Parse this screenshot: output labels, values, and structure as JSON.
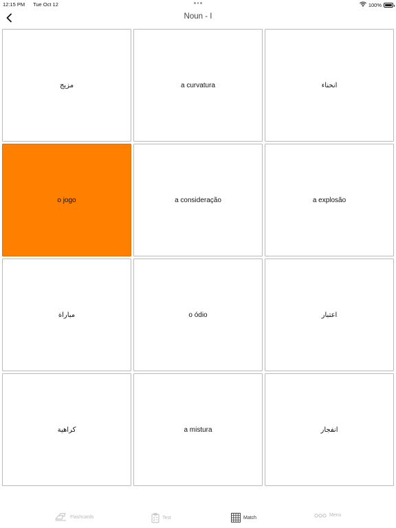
{
  "status": {
    "time": "12:15 PM",
    "date": "Tue Oct 12",
    "battery": "100%",
    "battery_level": 1.0
  },
  "nav": {
    "title": "Noun - I",
    "back_icon": "chevron-left-icon"
  },
  "cards": [
    {
      "text": "مزيج",
      "selected": false
    },
    {
      "text": "a curvatura",
      "selected": false
    },
    {
      "text": "انحناء",
      "selected": false
    },
    {
      "text": "o jogo",
      "selected": true
    },
    {
      "text": "a consideração",
      "selected": false
    },
    {
      "text": "a explosão",
      "selected": false
    },
    {
      "text": "مباراة",
      "selected": false
    },
    {
      "text": "o ódio",
      "selected": false
    },
    {
      "text": "اعتبار",
      "selected": false
    },
    {
      "text": "كراهية",
      "selected": false
    },
    {
      "text": "a mistura",
      "selected": false
    },
    {
      "text": "انفجار",
      "selected": false
    }
  ],
  "colors": {
    "selected_card": "#ff8000",
    "active_tab": "#333333",
    "inactive_tab": "#b8b8b8"
  },
  "tabs": {
    "flashcards": {
      "label": "Flashcards",
      "icon": "flashcards-icon",
      "active": false
    },
    "test": {
      "label": "Test",
      "icon": "clipboard-icon",
      "active": false
    },
    "match": {
      "label": "Match",
      "icon": "grid-icon",
      "active": true
    },
    "menu": {
      "label": "Menu",
      "icon": "more-dots-icon",
      "active": false
    }
  }
}
